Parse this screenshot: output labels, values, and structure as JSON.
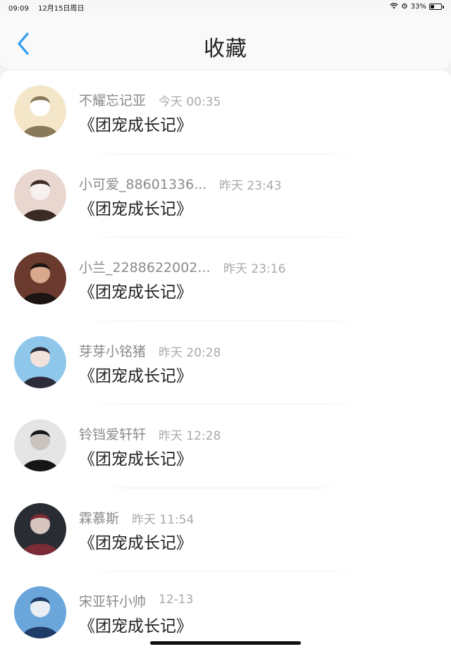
{
  "status_bar": {
    "time": "09:09",
    "date": "12月15日周日",
    "battery": "33%",
    "battery_level": 0.33
  },
  "header": {
    "title": "收藏",
    "back_icon": "chevron-left-icon",
    "accent_color": "#2f9bf0"
  },
  "favorites": [
    {
      "user": "不耀忘记亚",
      "time": "今天 00:35",
      "title": "《团宠成长记》"
    },
    {
      "user": "小可爱_88601336...",
      "time": "昨天 23:43",
      "title": "《团宠成长记》"
    },
    {
      "user": "小兰_2288622002...",
      "time": "昨天 23:16",
      "title": "《团宠成长记》"
    },
    {
      "user": "芽芽小铭猪",
      "time": "昨天 20:28",
      "title": "《团宠成长记》"
    },
    {
      "user": "铃铛爱轩轩",
      "time": "昨天 12:28",
      "title": "《团宠成长记》"
    },
    {
      "user": "霖慕斯",
      "time": "昨天 11:54",
      "title": "《团宠成长记》"
    },
    {
      "user": "宋亚轩小帅",
      "time": "12-13",
      "title": "《团宠成长记》"
    }
  ]
}
